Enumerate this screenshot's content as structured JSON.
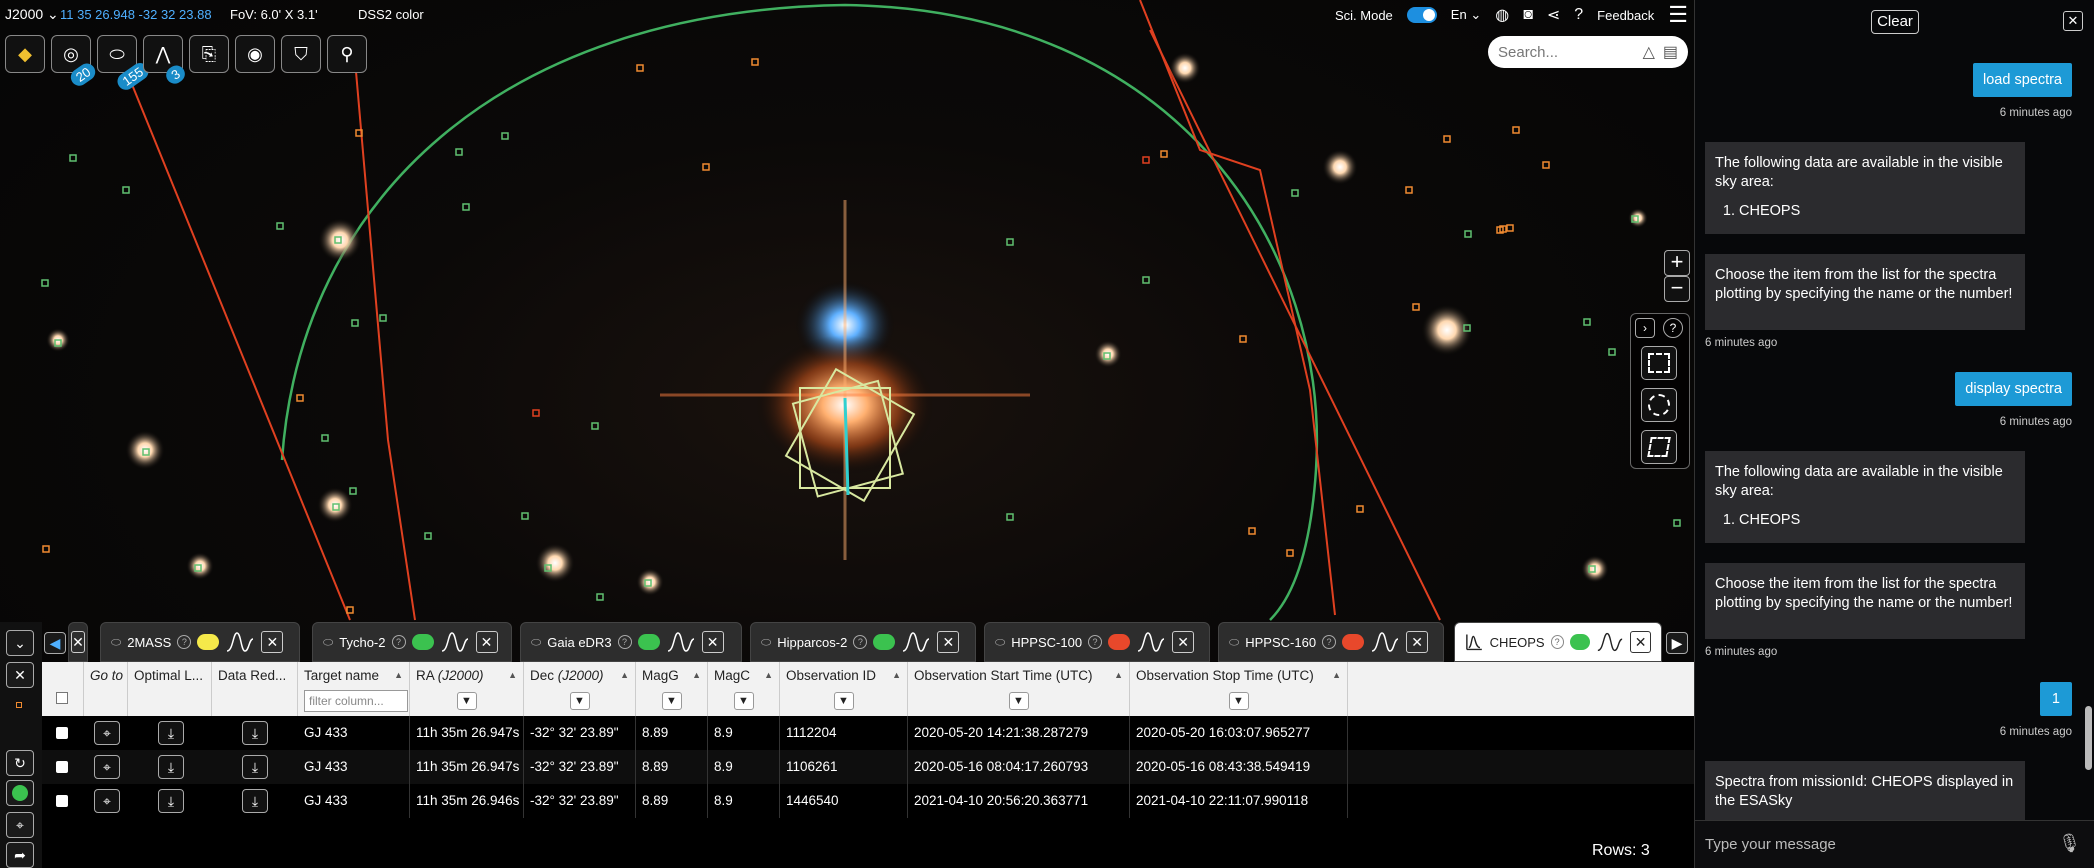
{
  "topbar": {
    "coord_system": "J2000",
    "coordinates": "11 35 26.948 -32 32 23.88",
    "fov": "FoV: 6.0' X 3.1'",
    "survey": "DSS2 color",
    "sci_mode_label": "Sci. Mode",
    "sci_mode_on": true,
    "language": "En",
    "feedback_label": "Feedback"
  },
  "toolbar": {
    "buttons": [
      "layers-icon",
      "galaxy-icon",
      "catalog-icon",
      "spectra-icon",
      "publications-icon",
      "target-list-icon",
      "graduation-icon",
      "telescope-icon"
    ],
    "badges": {
      "galaxy": "20",
      "catalog": "155",
      "spectra": "3"
    }
  },
  "search": {
    "placeholder": "Search..."
  },
  "tabs": [
    {
      "label": "2MASS",
      "color": "#f5e94a",
      "active": false
    },
    {
      "label": "Tycho-2",
      "color": "#3bc24f",
      "active": false
    },
    {
      "label": "Gaia eDR3",
      "color": "#3bc24f",
      "active": false
    },
    {
      "label": "Hipparcos-2",
      "color": "#3bc24f",
      "active": false
    },
    {
      "label": "HPPSC-100",
      "color": "#e8482b",
      "active": false
    },
    {
      "label": "HPPSC-160",
      "color": "#e8482b",
      "active": false
    },
    {
      "label": "CHEOPS",
      "color": "#3bc24f",
      "active": true
    }
  ],
  "table": {
    "headers": {
      "goto": "Go to",
      "optimal": "Optimal L...",
      "datared": "Data Red...",
      "target": "Target name",
      "ra": "RA",
      "ra_unit": "(J2000)",
      "dec": "Dec",
      "dec_unit": "(J2000)",
      "magg": "MagG",
      "magc": "MagC",
      "obsid": "Observation ID",
      "start": "Observation Start Time (UTC)",
      "stop": "Observation Stop Time (UTC)"
    },
    "filter_placeholder": "filter column...",
    "rows": [
      {
        "target": "GJ 433",
        "ra": "11h 35m 26.947s",
        "dec": "-32° 32' 23.89\"",
        "magg": "8.89",
        "magc": "8.9",
        "obsid": "1112204",
        "start": "2020-05-20 14:21:38.287279",
        "stop": "2020-05-20 16:03:07.965277"
      },
      {
        "target": "GJ 433",
        "ra": "11h 35m 26.947s",
        "dec": "-32° 32' 23.89\"",
        "magg": "8.89",
        "magc": "8.9",
        "obsid": "1106261",
        "start": "2020-05-16 08:04:17.260793",
        "stop": "2020-05-16 08:43:38.549419"
      },
      {
        "target": "GJ 433",
        "ra": "11h 35m 26.946s",
        "dec": "-32° 32' 23.89\"",
        "magg": "8.89",
        "magc": "8.9",
        "obsid": "1446540",
        "start": "2021-04-10 20:56:20.363771",
        "stop": "2021-04-10 22:11:07.990118"
      }
    ],
    "rows_count": "Rows: 3"
  },
  "chat": {
    "clear_label": "Clear",
    "messages": [
      {
        "role": "user",
        "text": "load spectra",
        "time": "6 minutes ago"
      },
      {
        "role": "bot",
        "text": "The following data are available in the visible sky area:",
        "list": [
          "CHEOPS"
        ]
      },
      {
        "role": "bot",
        "text": "Choose the item from the list for the spectra plotting by specifying the name or the number!",
        "time": "6 minutes ago"
      },
      {
        "role": "user",
        "text": "display spectra",
        "time": "6 minutes ago"
      },
      {
        "role": "bot",
        "text": "The following data are available in the visible sky area:",
        "list": [
          "CHEOPS"
        ]
      },
      {
        "role": "bot",
        "text": "Choose the item from the list for the spectra plotting by specifying the name or the number!",
        "time": "6 minutes ago"
      },
      {
        "role": "user",
        "text": "1",
        "time": "6 minutes ago"
      },
      {
        "role": "bot",
        "text": "Spectra from missionId: CHEOPS displayed in the ESASky"
      }
    ],
    "input_placeholder": "Type your message"
  }
}
